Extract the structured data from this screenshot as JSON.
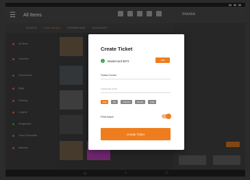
{
  "topbar": {
    "menu_icon": "☰",
    "title": "All Items",
    "invoice_title": "Invoice"
  },
  "tabs": [
    {
      "label": "TICKETS",
      "active": false
    },
    {
      "label": "PURCHASING",
      "active": true
    },
    {
      "label": "EXPENDITURE",
      "active": false
    },
    {
      "label": "DISCOUNTS",
      "active": false
    }
  ],
  "sidebar": {
    "items": [
      {
        "label": "All Items",
        "color": "#e0603c"
      },
      {
        "label": "Favorites",
        "color": "#e0603c"
      },
      {
        "label": "Accessories",
        "color": "#3aa24a"
      },
      {
        "label": "Bags",
        "color": "#e0603c"
      },
      {
        "label": "Clothing",
        "color": "#e0603c"
      },
      {
        "label": "Lingerie",
        "color": "#e0603c"
      },
      {
        "label": "Sunglasses",
        "color": "#3aa24a"
      },
      {
        "label": "Travel Essentials",
        "color": "#3b8fd6"
      },
      {
        "label": "Watches",
        "color": "#e0603c"
      }
    ]
  },
  "dialog": {
    "title": "Create Ticket",
    "card_label": "Mastercard 8872",
    "use_button": "Use",
    "name_value": "Sonia Corino",
    "note_placeholder": "Optional note",
    "chips": [
      {
        "label": "Hold",
        "active": true
      },
      {
        "label": "Bar",
        "active": false
      },
      {
        "label": "Credit inv",
        "active": false
      },
      {
        "label": "Receipt",
        "active": false
      },
      {
        "label": "Table",
        "active": false
      }
    ],
    "print_label": "Print ticket",
    "print_enabled": true,
    "create_button": "Create Ticket"
  },
  "nav": {
    "back": "◁",
    "home": "○",
    "recents": "□"
  },
  "colors": {
    "accent": "#ef7d1e",
    "success": "#3aa24a",
    "dim_overlay": "rgba(0,0,0,0.35)"
  }
}
